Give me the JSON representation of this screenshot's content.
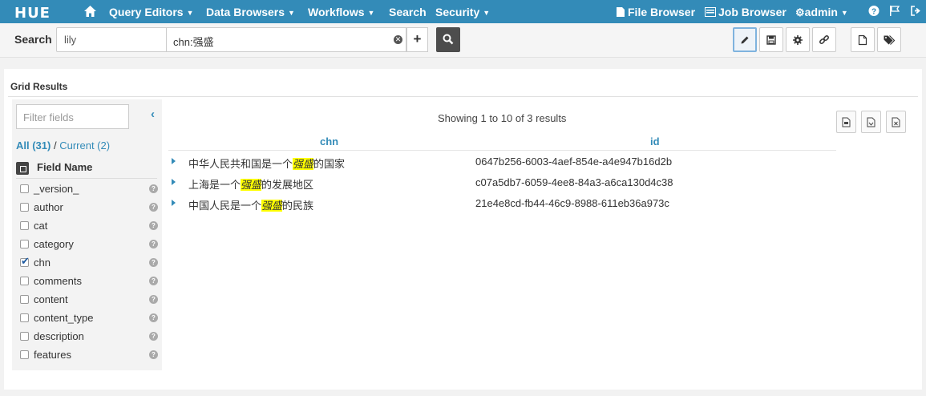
{
  "nav": {
    "logo": "HUE",
    "items": [
      {
        "label": "Query Editors",
        "has_menu": true
      },
      {
        "label": "Data Browsers",
        "has_menu": true
      },
      {
        "label": "Workflows",
        "has_menu": true
      },
      {
        "label": "Search",
        "has_menu": false
      },
      {
        "label": "Security",
        "has_menu": true
      }
    ],
    "file_browser": "File Browser",
    "job_browser": "Job Browser",
    "user": "admin",
    "color": "#338bb8"
  },
  "search": {
    "label": "Search",
    "collection": "lily",
    "query": "chn:强盛"
  },
  "toolbar": {
    "icons": [
      "pencil-icon",
      "save-icon",
      "gear-icon",
      "link-icon",
      "document-icon",
      "tags-icon"
    ]
  },
  "grid": {
    "title": "Grid Results",
    "filter_placeholder": "Filter fields",
    "all_label": "All (31)",
    "separator": "/",
    "current_label": "Current (2)",
    "field_header": "Field Name",
    "fields": [
      {
        "name": "_version_",
        "checked": false
      },
      {
        "name": "author",
        "checked": false
      },
      {
        "name": "cat",
        "checked": false
      },
      {
        "name": "category",
        "checked": false
      },
      {
        "name": "chn",
        "checked": true
      },
      {
        "name": "comments",
        "checked": false
      },
      {
        "name": "content",
        "checked": false
      },
      {
        "name": "content_type",
        "checked": false
      },
      {
        "name": "description",
        "checked": false
      },
      {
        "name": "features",
        "checked": false
      }
    ],
    "showing": "Showing 1 to 10 of 3 results",
    "columns": [
      "chn",
      "id"
    ],
    "rows": [
      {
        "pre": "中华人民共和国是一个",
        "hl": "强盛",
        "post": "的国家",
        "id": "0647b256-6003-4aef-854e-a4e947b16d2b"
      },
      {
        "pre": "上海是一个",
        "hl": "强盛",
        "post": "的发展地区",
        "id": "c07a5db7-6059-4ee8-84a3-a6ca130d4c38"
      },
      {
        "pre": "中国人民是一个",
        "hl": "强盛",
        "post": "的民族",
        "id": "21e4e8cd-fb44-46c9-8988-611eb36a973c"
      }
    ]
  }
}
